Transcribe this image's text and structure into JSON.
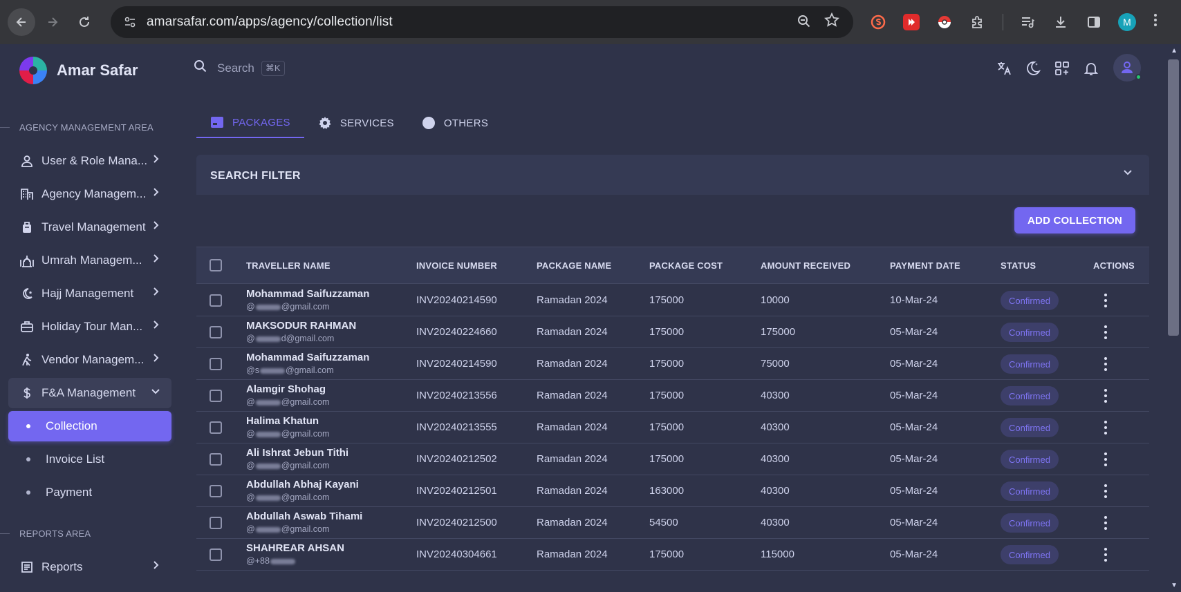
{
  "browser": {
    "url": "amarsafar.com/apps/agency/collection/list",
    "profile_initial": "M"
  },
  "brand": {
    "name": "Amar Safar"
  },
  "search": {
    "placeholder": "Search",
    "shortcut": "⌘K"
  },
  "sidebar": {
    "section_agency": "AGENCY MANAGEMENT AREA",
    "section_reports": "REPORTS AREA",
    "items": [
      {
        "label": "User & Role Mana...",
        "icon": "user-icon"
      },
      {
        "label": "Agency Managem...",
        "icon": "building-icon"
      },
      {
        "label": "Travel Management",
        "icon": "luggage-icon"
      },
      {
        "label": "Umrah Managem...",
        "icon": "mosque-icon"
      },
      {
        "label": "Hajj Management",
        "icon": "moon-star-icon"
      },
      {
        "label": "Holiday Tour Man...",
        "icon": "briefcase-icon"
      },
      {
        "label": "Vendor Managem...",
        "icon": "walking-icon"
      },
      {
        "label": "F&A Management",
        "icon": "dollar-icon"
      }
    ],
    "sub_items": [
      {
        "label": "Collection"
      },
      {
        "label": "Invoice List"
      },
      {
        "label": "Payment"
      }
    ],
    "reports": {
      "label": "Reports",
      "icon": "report-icon"
    }
  },
  "tabs": [
    {
      "label": "PACKAGES"
    },
    {
      "label": "SERVICES"
    },
    {
      "label": "OTHERS"
    }
  ],
  "filter": {
    "title": "SEARCH FILTER"
  },
  "actions": {
    "add_collection": "ADD COLLECTION"
  },
  "table": {
    "headers": [
      "TRAVELLER NAME",
      "INVOICE NUMBER",
      "PACKAGE NAME",
      "PACKAGE COST",
      "AMOUNT RECEIVED",
      "PAYMENT DATE",
      "STATUS",
      "ACTIONS"
    ],
    "rows": [
      {
        "name": "Mohammad Saifuzzaman",
        "email_prefix": "@",
        "email_suffix": "@gmail.com",
        "invoice": "INV20240214590",
        "package": "Ramadan 2024",
        "cost": "175000",
        "received": "10000",
        "date": "10-Mar-24",
        "status": "Confirmed"
      },
      {
        "name": "MAKSODUR RAHMAN",
        "email_prefix": "@",
        "email_suffix": "d@gmail.com",
        "invoice": "INV20240224660",
        "package": "Ramadan 2024",
        "cost": "175000",
        "received": "175000",
        "date": "05-Mar-24",
        "status": "Confirmed"
      },
      {
        "name": "Mohammad Saifuzzaman",
        "email_prefix": "@s",
        "email_suffix": "@gmail.com",
        "invoice": "INV20240214590",
        "package": "Ramadan 2024",
        "cost": "175000",
        "received": "75000",
        "date": "05-Mar-24",
        "status": "Confirmed"
      },
      {
        "name": "Alamgir Shohag",
        "email_prefix": "@",
        "email_suffix": "@gmail.com",
        "invoice": "INV20240213556",
        "package": "Ramadan 2024",
        "cost": "175000",
        "received": "40300",
        "date": "05-Mar-24",
        "status": "Confirmed"
      },
      {
        "name": "Halima Khatun",
        "email_prefix": "@",
        "email_suffix": "@gmail.com",
        "invoice": "INV20240213555",
        "package": "Ramadan 2024",
        "cost": "175000",
        "received": "40300",
        "date": "05-Mar-24",
        "status": "Confirmed"
      },
      {
        "name": "Ali Ishrat Jebun Tithi",
        "email_prefix": "@",
        "email_suffix": "@gmail.com",
        "invoice": "INV20240212502",
        "package": "Ramadan 2024",
        "cost": "175000",
        "received": "40300",
        "date": "05-Mar-24",
        "status": "Confirmed"
      },
      {
        "name": "Abdullah Abhaj Kayani",
        "email_prefix": "@",
        "email_suffix": "@gmail.com",
        "invoice": "INV20240212501",
        "package": "Ramadan 2024",
        "cost": "163000",
        "received": "40300",
        "date": "05-Mar-24",
        "status": "Confirmed"
      },
      {
        "name": "Abdullah Aswab Tihami",
        "email_prefix": "@",
        "email_suffix": "@gmail.com",
        "invoice": "INV20240212500",
        "package": "Ramadan 2024",
        "cost": "54500",
        "received": "40300",
        "date": "05-Mar-24",
        "status": "Confirmed"
      },
      {
        "name": "SHAHREAR AHSAN",
        "email_prefix": "@+88",
        "email_suffix": "",
        "invoice": "INV20240304661",
        "package": "Ramadan 2024",
        "cost": "175000",
        "received": "115000",
        "date": "05-Mar-24",
        "status": "Confirmed"
      }
    ]
  },
  "colors": {
    "primary": "#7367f0",
    "background": "#2f3349",
    "panel": "#353a54"
  }
}
